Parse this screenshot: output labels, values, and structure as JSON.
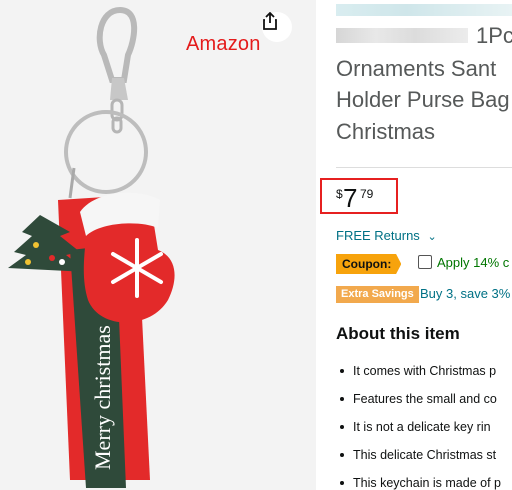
{
  "watermark": "Amazon",
  "share": {
    "icon": "share-icon"
  },
  "product": {
    "title_part1": "1Pc",
    "title_lines": [
      "Ornaments Sant",
      "Holder Purse Bag",
      "Christmas"
    ],
    "strap_text": "Merry christmas"
  },
  "price": {
    "symbol": "$",
    "whole": "7",
    "fraction": "79"
  },
  "shipping": {
    "free_returns": "FREE Returns",
    "chevron": "⌄"
  },
  "coupon": {
    "badge": "Coupon:",
    "text": "Apply 14% c"
  },
  "extra_savings": {
    "badge": "Extra Savings",
    "link": "Buy 3, save 3%"
  },
  "about": {
    "heading": "About this item",
    "bullets": [
      "It comes with Christmas p",
      "Features the small and co",
      "It is not a delicate key rin",
      "This delicate Christmas st",
      "This keychain is made of p"
    ]
  },
  "colors": {
    "accent_link": "#007185",
    "coupon": "#f7a30c",
    "price_highlight": "#e62020",
    "green": "#007600"
  }
}
